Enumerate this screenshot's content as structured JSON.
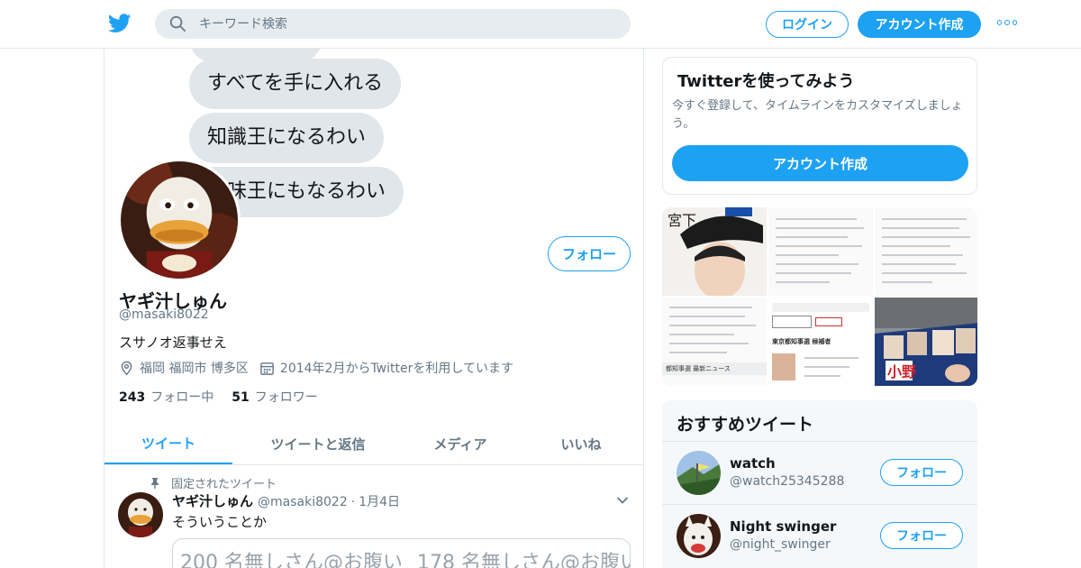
{
  "nav": {
    "search_placeholder": "キーワード検索",
    "login_label": "ログイン",
    "signup_label": "アカウント作成",
    "more_icon": "more-dots-icon",
    "logo_icon": "twitter-bird-icon",
    "accent_color": "#1da1f2"
  },
  "banner": {
    "bubbles": [
      "",
      "すべてを手に入れる",
      "知識王になるわい",
      "趣味王にもなるわい"
    ]
  },
  "profile": {
    "follow_label": "フォロー",
    "name": "ヤギ汁しゅん",
    "handle": "@masaki8022",
    "bio": "スサノオ返事せえ",
    "location": "福岡 福岡市 博多区",
    "joined": "2014年2月からTwitterを利用しています",
    "following_count": "243",
    "following_label": "フォロー中",
    "followers_count": "51",
    "followers_label": "フォロワー"
  },
  "tabs": [
    {
      "label": "ツイート",
      "active": true
    },
    {
      "label": "ツイートと返信",
      "active": false
    },
    {
      "label": "メディア",
      "active": false
    },
    {
      "label": "いいね",
      "active": false
    }
  ],
  "pinned_tweet": {
    "pinned_label": "固定されたツイート",
    "name": "ヤギ汁しゅん",
    "handle": "@masaki8022",
    "separator": "·",
    "date": "1月4日",
    "text": "そういうことか",
    "card_left": "200 名無しさん@お腹い",
    "card_right": "178 名無しさん@お腹い"
  },
  "signup_card": {
    "title": "Twitterを使ってみよう",
    "subtitle": "今すぐ登録して、タイムラインをカスタマイズしましょう。",
    "button": "アカウント作成"
  },
  "media": {
    "tile_text_1": "宮下",
    "tile_text_2": "都知事選 最新ニュース",
    "tile_text_3": "東京都知事選 候補者",
    "tile_text_4": "小野"
  },
  "recommend": {
    "title": "おすすめツイート",
    "users": [
      {
        "name": "watch",
        "handle": "@watch25345288",
        "follow": "フォロー"
      },
      {
        "name": "Night swinger",
        "handle": "@night_swinger",
        "follow": "フォロー"
      }
    ]
  }
}
